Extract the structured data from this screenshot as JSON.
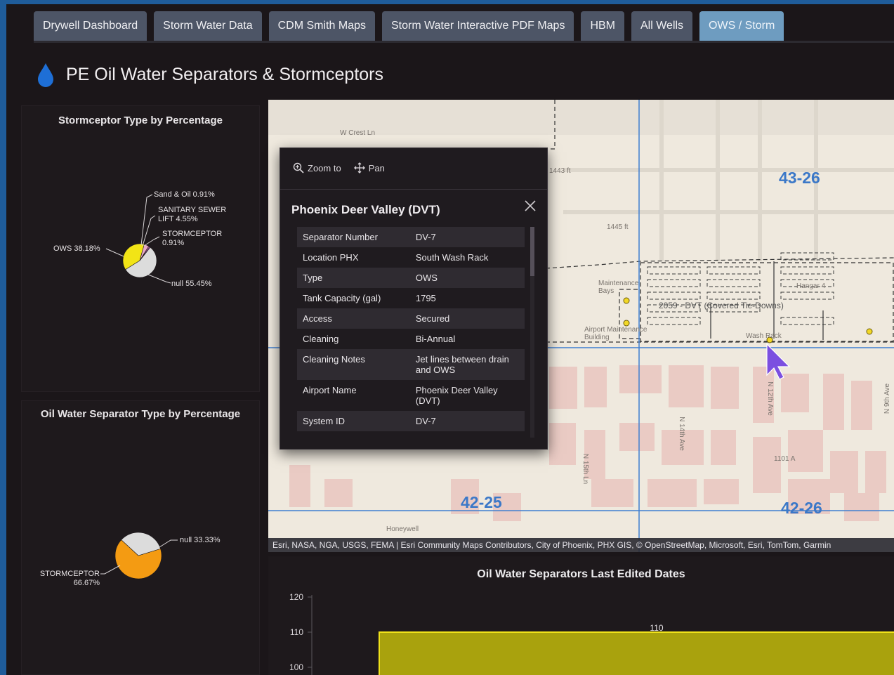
{
  "tabs": [
    {
      "label": "Drywell Dashboard",
      "active": false
    },
    {
      "label": "Storm Water Data",
      "active": false
    },
    {
      "label": "CDM Smith Maps",
      "active": false
    },
    {
      "label": "Storm Water Interactive PDF Maps",
      "active": false
    },
    {
      "label": "HBM",
      "active": false
    },
    {
      "label": "All Wells",
      "active": false
    },
    {
      "label": "OWS / Storm",
      "active": true
    }
  ],
  "header": {
    "title": "PE Oil Water Separators & Stormceptors",
    "icon": "water-drop-icon"
  },
  "stormceptor_panel": {
    "title": "Stormceptor Type by Percentage"
  },
  "ows_panel": {
    "title": "Oil Water Separator Type by Percentage"
  },
  "map": {
    "grid_labels": [
      "43-26",
      "42-25",
      "42-26"
    ],
    "streets": [
      "W Crest Ln",
      "1443 ft",
      "1445 ft",
      "Maintenance Bays",
      "Airport Maintenance Building",
      "2059 - DVT (Covered Tie-Downs)",
      "Hangar 4",
      "Wash Rack",
      "N 12th Ave",
      "N 14th Ave",
      "N 15th Ln",
      "N 9th Ave",
      "1101 A",
      "Honeywell"
    ],
    "attribution": "Esri, NASA, NGA, USGS, FEMA | Esri Community Maps Contributors, City of Phoenix, PHX GIS, © OpenStreetMap, Microsoft, Esri, TomTom, Garmin"
  },
  "popup": {
    "zoom_label": "Zoom to",
    "pan_label": "Pan",
    "title": "Phoenix Deer Valley (DVT)",
    "attributes": [
      {
        "key": "Separator Number",
        "value": "DV-7"
      },
      {
        "key": "Location PHX",
        "value": "South Wash Rack"
      },
      {
        "key": "Type",
        "value": "OWS"
      },
      {
        "key": "Tank Capacity (gal)",
        "value": "1795"
      },
      {
        "key": "Access",
        "value": "Secured"
      },
      {
        "key": "Cleaning",
        "value": "Bi-Annual"
      },
      {
        "key": "Cleaning Notes",
        "value": "Jet lines between drain and OWS"
      },
      {
        "key": "Airport Name",
        "value": "Phoenix Deer Valley (DVT)"
      },
      {
        "key": "System ID",
        "value": "DV-7"
      }
    ]
  },
  "colors": {
    "accent_tab": "#6e9cc0",
    "drop": "#1e6fd6",
    "ows_yellow": "#f2e416",
    "stormceptor_orange": "#f49b12",
    "null_gray": "#dcdcdc",
    "sand_oil_pink": "#f08bb5",
    "bar_yellow": "#f0e21a"
  },
  "chart_data": [
    {
      "type": "pie",
      "title": "Stormceptor Type by Percentage",
      "slices": [
        {
          "label": "null",
          "value": 55.45
        },
        {
          "label": "OWS",
          "value": 38.18
        },
        {
          "label": "SANITARY SEWER LIFT",
          "value": 4.55
        },
        {
          "label": "Sand & Oil",
          "value": 0.91
        },
        {
          "label": "STORMCEPTOR",
          "value": 0.91
        }
      ],
      "display_labels": [
        "null 55.45%",
        "OWS 38.18%",
        "SANITARY SEWER LIFT 4.55%",
        "Sand & Oil 0.91%",
        "STORMCEPTOR 0.91%"
      ]
    },
    {
      "type": "pie",
      "title": "Oil Water Separator Type by Percentage",
      "slices": [
        {
          "label": "STORMCEPTOR",
          "value": 66.67
        },
        {
          "label": "null",
          "value": 33.33
        }
      ],
      "display_labels": [
        "STORMCEPTOR 66.67%",
        "null 33.33%"
      ]
    },
    {
      "type": "bar",
      "title": "Oil Water Separators Last Edited Dates",
      "y_ticks": [
        "120",
        "110",
        "100"
      ],
      "ylim": [
        100,
        120
      ],
      "values": [
        110
      ],
      "data_labels": [
        "110"
      ]
    }
  ]
}
